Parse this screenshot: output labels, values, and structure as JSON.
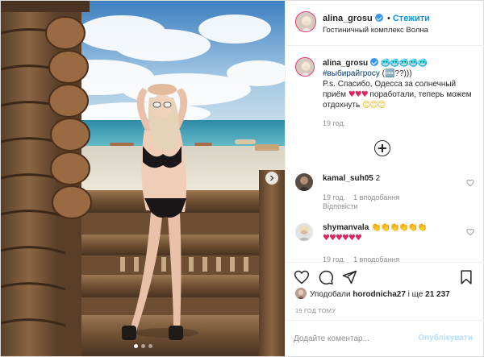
{
  "post": {
    "author": "alina_grosu",
    "follow_separator": "•",
    "follow_label": "Стежити",
    "location": "Гостиничный комплекс Волна"
  },
  "caption": {
    "username": "alina_grosu",
    "emoji_line": "🥶🥶🥶🥶🥶",
    "hashtag": "#выбирайгросу",
    "hashtag_suffix": " (🆒??)))",
    "text_part1": "P.s. Спасибо, Одесса за солнечный приём ",
    "hearts": "♥♥♥",
    "text_part2": " поработали, теперь можем отдохнуть ",
    "emojis_end": "😊😊😊",
    "time": "19 год."
  },
  "comments": [
    {
      "username": "kamal_suh05",
      "text": "2",
      "time": "19 год.",
      "likes": "1 вподобання",
      "reply": "Відповісти"
    },
    {
      "username": "shymanvala",
      "text_emojis": "👏👏👏👏👏👏",
      "text_hearts": "♥♥♥♥♥♥",
      "time": "19 год.",
      "likes": "1 вподобання"
    }
  ],
  "likes": {
    "prefix": "Уподобали ",
    "user": "horodnicha27",
    "middle": " і ще ",
    "count": "21 237"
  },
  "post_time": "19 ГОД ТОМУ",
  "add_comment": {
    "placeholder": "Додайте коментар...",
    "publish_label": "Опублікувати"
  },
  "carousel": {
    "count": 3,
    "active_index": 0
  },
  "colors": {
    "accent": "#0095f6",
    "verified": "#3897f0",
    "hashtag": "#00376b",
    "muted": "#8e8e8e",
    "publish_disabled": "#b2dffc"
  }
}
